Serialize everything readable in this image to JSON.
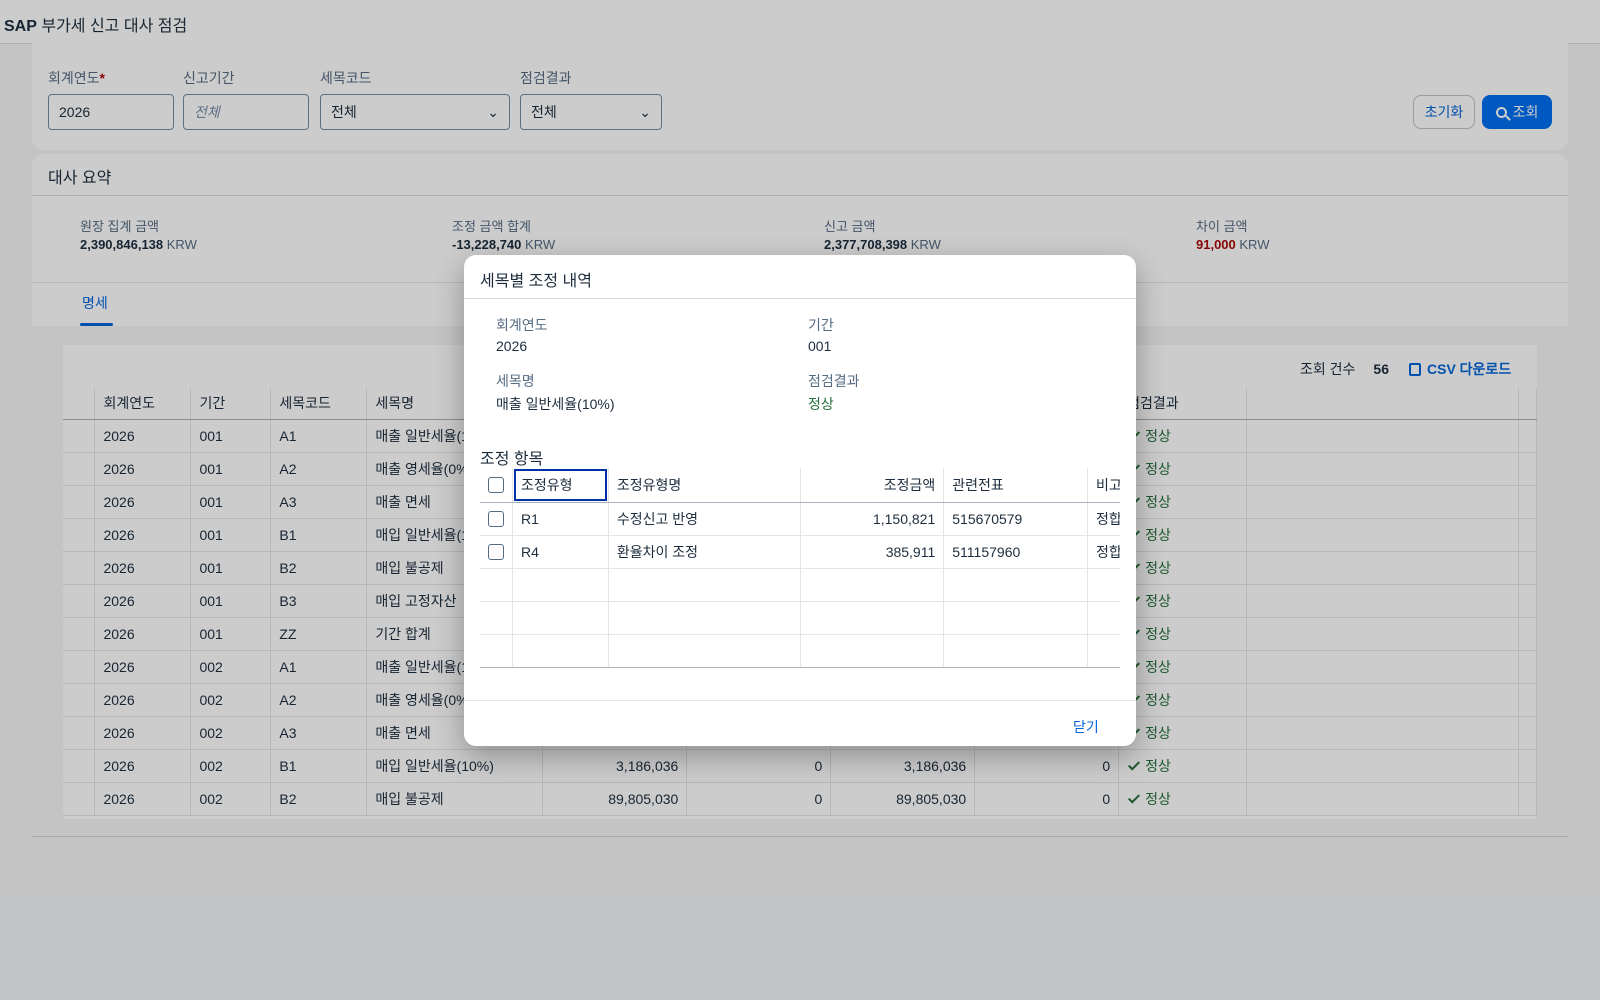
{
  "app": {
    "brand": "SAP",
    "title": "부가세 신고 대사 점검"
  },
  "filters": {
    "fiscal_year": {
      "label": "회계연도",
      "required_mark": "*",
      "value": "2026"
    },
    "period": {
      "label": "신고기간",
      "placeholder": "전체"
    },
    "tax_code": {
      "label": "세목코드",
      "value": "전체"
    },
    "result": {
      "label": "점검결과",
      "value": "전체"
    },
    "reset_label": "초기화",
    "go_label": "조회"
  },
  "summary": {
    "title": "대사 요약",
    "kpis": [
      {
        "label": "원장 집계 금액",
        "value": "2,390,846,138",
        "unit": "KRW"
      },
      {
        "label": "조정 금액 합계",
        "value": "-13,228,740",
        "unit": "KRW"
      },
      {
        "label": "신고 금액",
        "value": "2,377,708,398",
        "unit": "KRW"
      },
      {
        "label": "차이 금액",
        "value": "91,000",
        "unit": "KRW"
      }
    ]
  },
  "tabs": {
    "detail": "명세"
  },
  "table": {
    "count_label": "조회 건수",
    "count": "56",
    "csv_label": "CSV 다운로드",
    "columns": [
      "회계연도",
      "기간",
      "세목코드",
      "세목명",
      "",
      "",
      "",
      "",
      "점검결과"
    ],
    "rows": [
      {
        "year": "2026",
        "period": "001",
        "code": "A1",
        "name": "매출 일반세율(10%)",
        "c1": "",
        "c2": "",
        "c3": "",
        "c4": "",
        "result": "정상"
      },
      {
        "year": "2026",
        "period": "001",
        "code": "A2",
        "name": "매출 영세율(0%)",
        "c1": "",
        "c2": "",
        "c3": "",
        "c4": "",
        "result": "정상"
      },
      {
        "year": "2026",
        "period": "001",
        "code": "A3",
        "name": "매출 면세",
        "c1": "",
        "c2": "",
        "c3": "",
        "c4": "",
        "result": "정상"
      },
      {
        "year": "2026",
        "period": "001",
        "code": "B1",
        "name": "매입 일반세율(10%)",
        "c1": "",
        "c2": "",
        "c3": "",
        "c4": "",
        "result": "정상"
      },
      {
        "year": "2026",
        "period": "001",
        "code": "B2",
        "name": "매입 불공제",
        "c1": "",
        "c2": "",
        "c3": "",
        "c4": "",
        "result": "정상"
      },
      {
        "year": "2026",
        "period": "001",
        "code": "B3",
        "name": "매입 고정자산",
        "c1": "",
        "c2": "",
        "c3": "",
        "c4": "",
        "result": "정상"
      },
      {
        "year": "2026",
        "period": "001",
        "code": "ZZ",
        "name": "기간 합계",
        "c1": "",
        "c2": "",
        "c3": "",
        "c4": "",
        "result": "정상"
      },
      {
        "year": "2026",
        "period": "002",
        "code": "A1",
        "name": "매출 일반세율(10%)",
        "c1": "",
        "c2": "",
        "c3": "",
        "c4": "",
        "result": "정상"
      },
      {
        "year": "2026",
        "period": "002",
        "code": "A2",
        "name": "매출 영세율(0%)",
        "c1": "",
        "c2": "",
        "c3": "",
        "c4": "",
        "result": "정상"
      },
      {
        "year": "2026",
        "period": "002",
        "code": "A3",
        "name": "매출 면세",
        "c1": "",
        "c2": "",
        "c3": "",
        "c4": "",
        "result": "정상"
      },
      {
        "year": "2026",
        "period": "002",
        "code": "B1",
        "name": "매입 일반세율(10%)",
        "c1": "3,186,036",
        "c2": "0",
        "c3": "3,186,036",
        "c4": "0",
        "result": "정상"
      },
      {
        "year": "2026",
        "period": "002",
        "code": "B2",
        "name": "매입 불공제",
        "c1": "89,805,030",
        "c2": "0",
        "c3": "89,805,030",
        "c4": "0",
        "result": "정상"
      }
    ]
  },
  "dialog": {
    "title": "세목별 조정 내역",
    "fields": {
      "year_label": "회계연도",
      "year": "2026",
      "period_label": "기간",
      "period": "001",
      "name_label": "세목명",
      "name": "매출 일반세율(10%)",
      "result_label": "점검결과",
      "result": "정상"
    },
    "section_title": "조정 항목",
    "columns": [
      "조정유형",
      "조정유형명",
      "조정금액",
      "관련전표",
      "비고"
    ],
    "rows": [
      {
        "type": "R1",
        "type_name": "수정신고 반영",
        "amount": "1,150,821",
        "doc": "515670579",
        "note": "정합"
      },
      {
        "type": "R4",
        "type_name": "환율차이 조정",
        "amount": "385,911",
        "doc": "511157960",
        "note": "정합"
      }
    ],
    "close_label": "닫기"
  }
}
